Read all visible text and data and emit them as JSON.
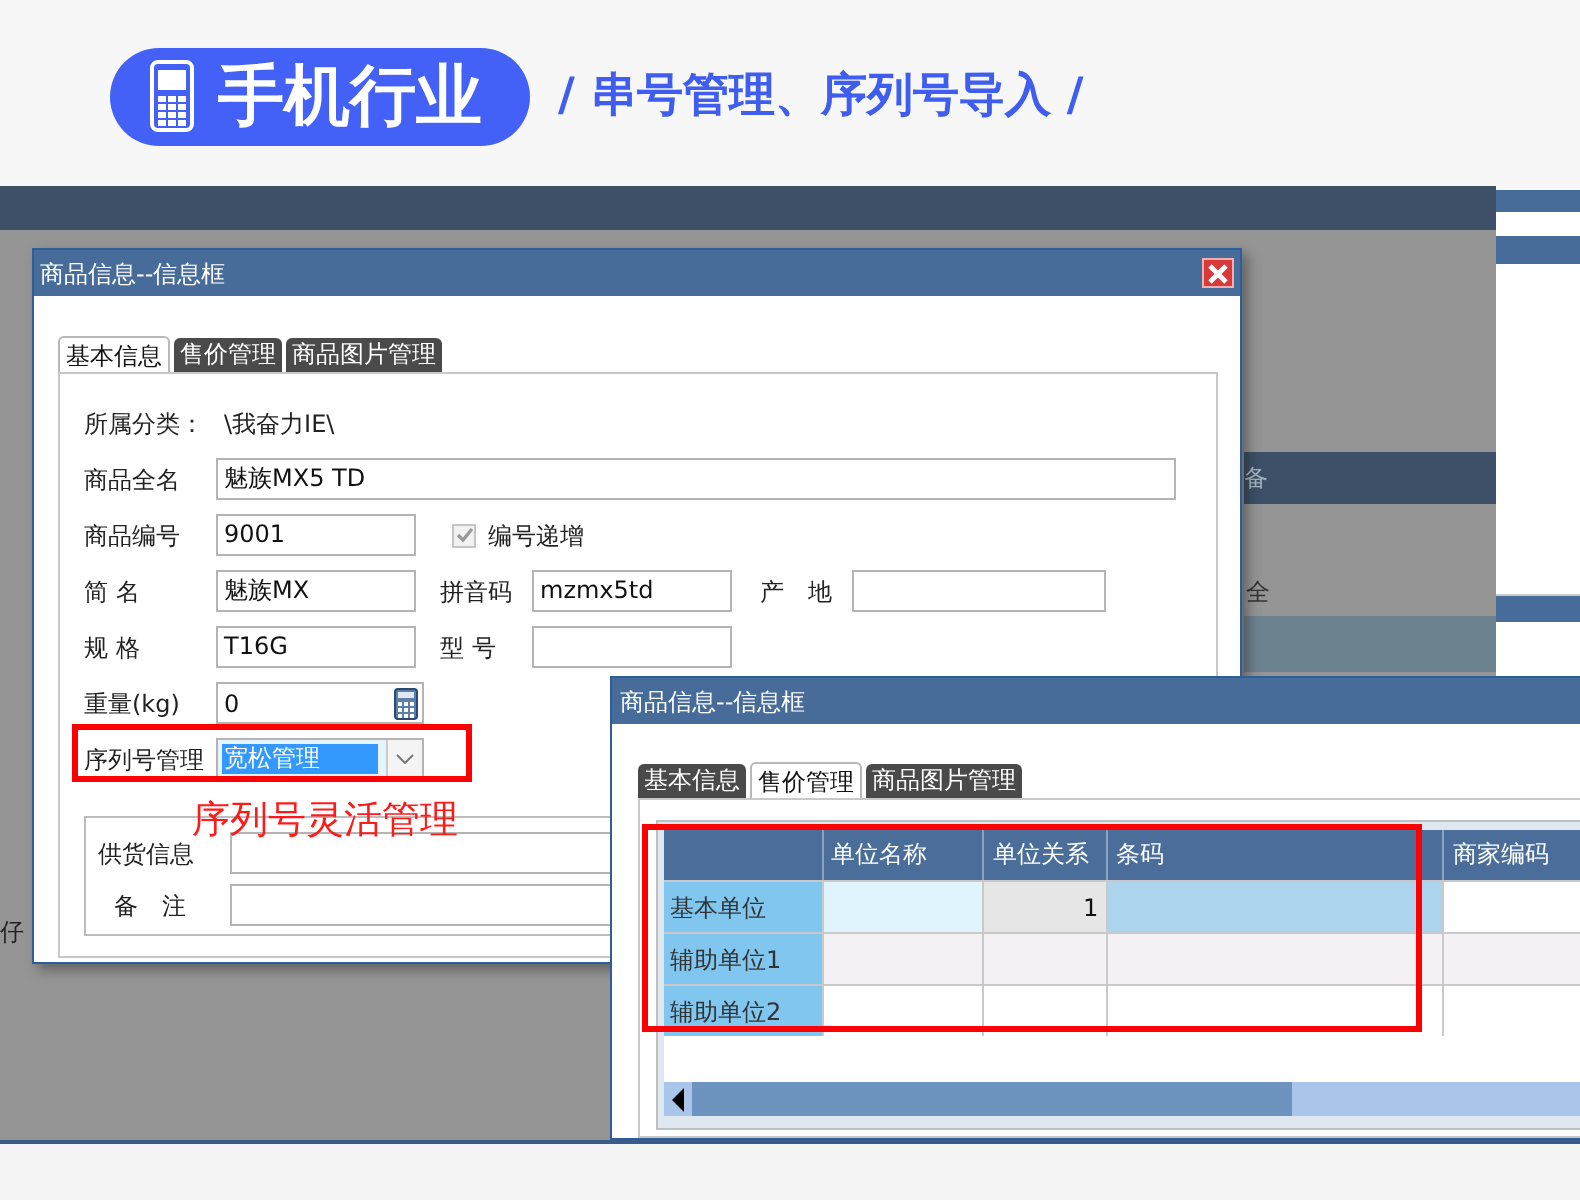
{
  "banner": {
    "title": "手机行业",
    "subtitle": "/ 串号管理、序列号导入 /"
  },
  "background": {
    "fragments": [
      "备",
      "全",
      "仔"
    ]
  },
  "dialog_1": {
    "title": "商品信息--信息框",
    "tabs": [
      {
        "label": "基本信息",
        "selected": true
      },
      {
        "label": "售价管理",
        "selected": false
      },
      {
        "label": "商品图片管理",
        "selected": false
      }
    ],
    "category": {
      "label": "所属分类：",
      "value": "\\我奋力IE\\"
    },
    "full_name": {
      "label": "商品全名",
      "value": "魅族MX5 TD"
    },
    "code": {
      "label": "商品编号",
      "value": "9001"
    },
    "auto_increment": {
      "label": "编号递增",
      "checked": true,
      "disabled": true
    },
    "short_name": {
      "label": "简 名",
      "value": "魅族MX"
    },
    "pinyin": {
      "label": "拼音码",
      "value": "mzmx5td"
    },
    "origin": {
      "label": "产　地"
    },
    "spec": {
      "label": "规 格",
      "value": "T16G"
    },
    "model": {
      "label": "型 号"
    },
    "weight": {
      "label": "重量(kg)",
      "value": "0"
    },
    "serial_mode": {
      "label": "序列号管理",
      "value": "宽松管理",
      "selected": true
    },
    "supply": {
      "label": "供货信息"
    },
    "remark": {
      "label": "备　注"
    }
  },
  "annotation": "序列号灵活管理",
  "dialog_2": {
    "title": "商品信息--信息框",
    "tabs": [
      {
        "label": "基本信息",
        "selected": false
      },
      {
        "label": "售价管理",
        "selected": true
      },
      {
        "label": "商品图片管理",
        "selected": false
      }
    ],
    "grid": {
      "columns": [
        "单位名称",
        "单位关系",
        "条码",
        "商家编码"
      ],
      "rows": [
        {
          "label": "基本单位",
          "relation": "1",
          "selected": true
        },
        {
          "label": "辅助单位1",
          "selected": false
        },
        {
          "label": "辅助单位2",
          "selected": false
        }
      ]
    }
  }
}
